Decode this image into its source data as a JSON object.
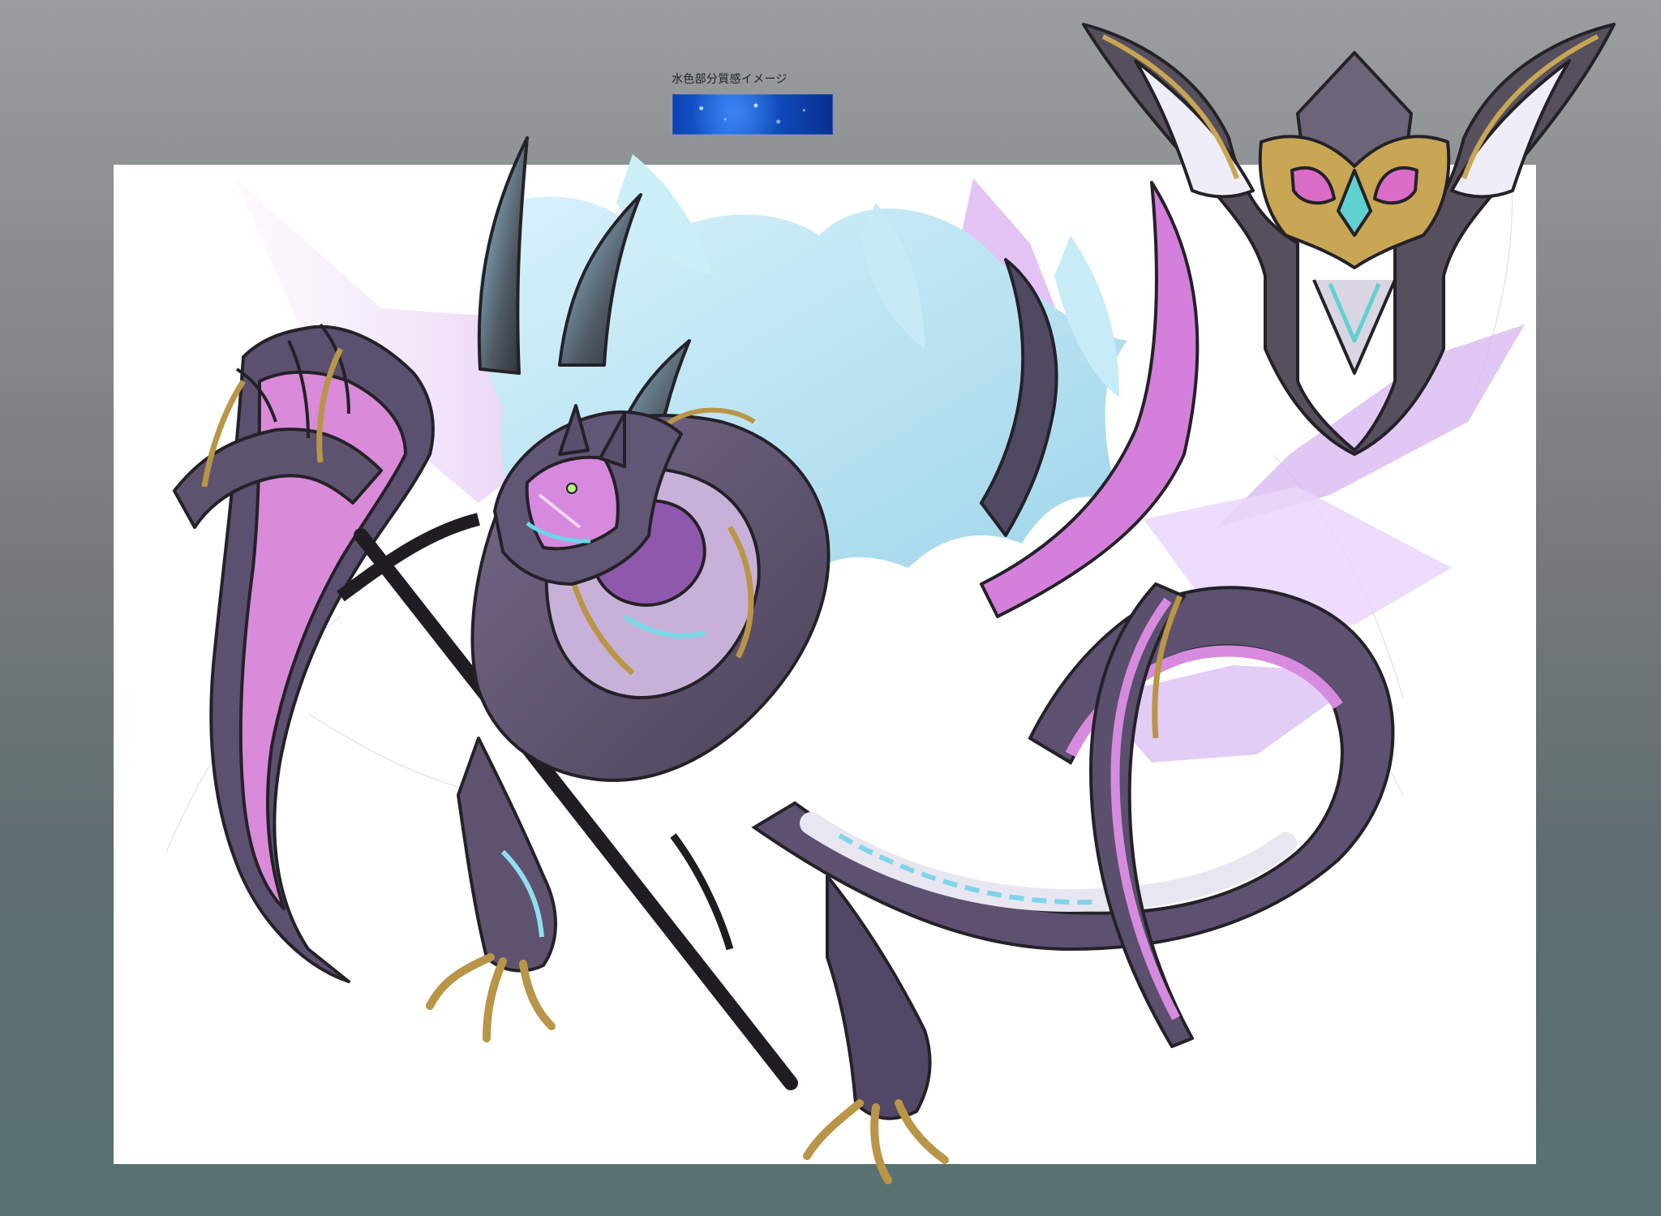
{
  "header": {
    "texture_note": "水色部分質感イメージ"
  },
  "artwork": {
    "subject": "dragon-scythe-creature-concept",
    "swatch_color": "#1d6de2",
    "palette": {
      "outline": "#242127",
      "violet": "#5d526c",
      "pink": "#d287d9",
      "aqua": "#bfe7f3",
      "gold": "#b99548",
      "pale": "#ecebf2"
    }
  }
}
